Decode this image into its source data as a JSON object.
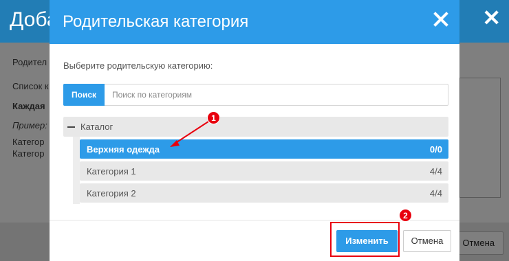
{
  "background": {
    "title": "Доба",
    "lines": [
      "Родител",
      "Список к",
      "Каждая",
      "Пример:",
      "Категор",
      "Категор"
    ],
    "cancel_label": "Отмена"
  },
  "modal": {
    "title": "Родительская категория",
    "prompt": "Выберите родительскую категорию:",
    "search": {
      "button_label": "Поиск",
      "placeholder": "Поиск по категориям",
      "value": ""
    },
    "tree": {
      "root_label": "Каталог",
      "items": [
        {
          "label": "Верхняя одежда",
          "count": "0/0",
          "selected": true
        },
        {
          "label": "Категория 1",
          "count": "4/4",
          "selected": false
        },
        {
          "label": "Категория 2",
          "count": "4/4",
          "selected": false
        }
      ]
    },
    "footer": {
      "apply_label": "Изменить",
      "cancel_label": "Отмена"
    }
  },
  "annotations": {
    "badge_1": "1",
    "badge_2": "2"
  },
  "colors": {
    "accent": "#2d9be8",
    "annotation": "#e8000e"
  }
}
